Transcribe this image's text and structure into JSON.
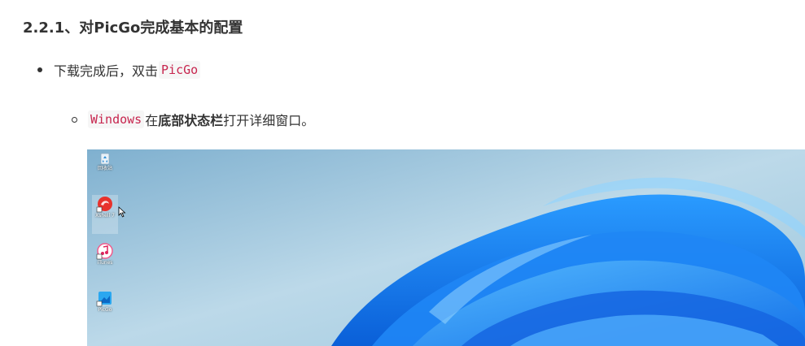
{
  "heading": "2.2.1、对PicGo完成基本的配置",
  "bullet1": {
    "text": "下载完成后，双击",
    "code": "PicGo"
  },
  "bullet2": {
    "code": "Windows",
    "text_before": "在",
    "bold": "底部状态栏",
    "text_after": "打开详细窗口。"
  },
  "desktop": {
    "icons": [
      {
        "name": "recycle-bin",
        "label": "回收站"
      },
      {
        "name": "xshell",
        "label": "Xshell 7"
      },
      {
        "name": "itunes",
        "label": "iTunes"
      },
      {
        "name": "picgo",
        "label": "PicGo"
      }
    ],
    "colors": {
      "sky": "#a9cde2",
      "bloom": "#1a7ef2"
    }
  }
}
